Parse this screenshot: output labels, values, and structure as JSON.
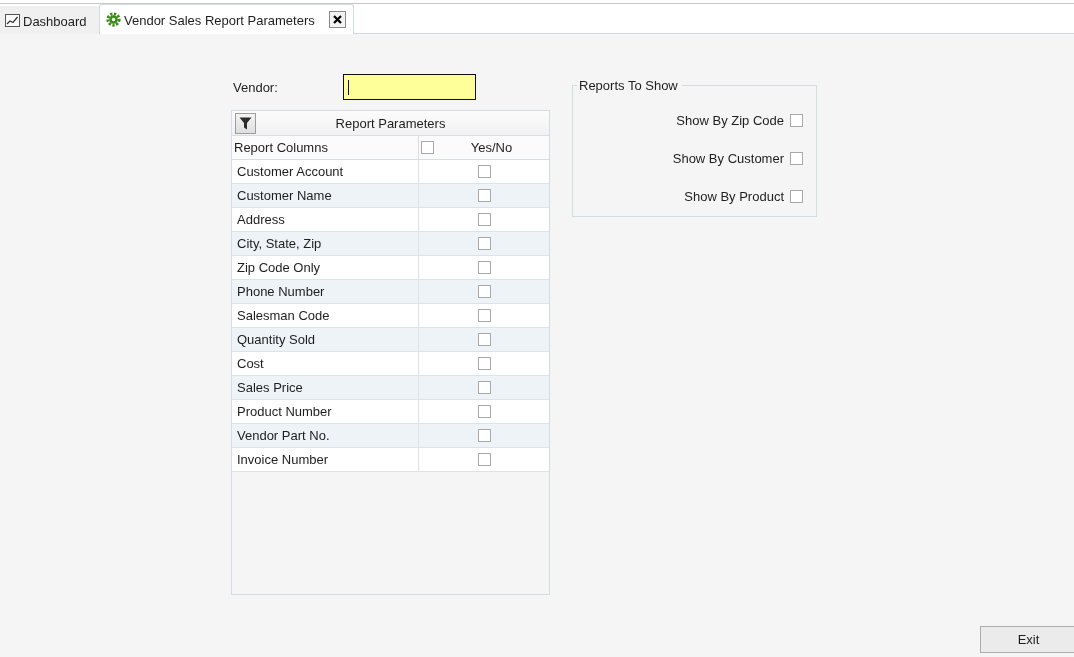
{
  "tabs": [
    {
      "label": "Dashboard",
      "kind": "chart",
      "selected": false,
      "closable": false
    },
    {
      "label": "Vendor Sales Report Parameters",
      "kind": "gear",
      "selected": true,
      "closable": true
    }
  ],
  "vendor": {
    "label": "Vendor:",
    "focused": true
  },
  "report_parameters": {
    "title": "Report Parameters",
    "columns": [
      "Report Columns",
      "Yes/No"
    ],
    "select_all_checked": false,
    "rows": [
      {
        "label": "Customer Account",
        "checked": false
      },
      {
        "label": "Customer Name",
        "checked": false
      },
      {
        "label": "Address",
        "checked": false
      },
      {
        "label": "City, State, Zip",
        "checked": false
      },
      {
        "label": "Zip Code Only",
        "checked": false
      },
      {
        "label": "Phone Number",
        "checked": false
      },
      {
        "label": "Salesman Code",
        "checked": false
      },
      {
        "label": "Quantity Sold",
        "checked": false
      },
      {
        "label": "Cost",
        "checked": false
      },
      {
        "label": "Sales Price",
        "checked": false
      },
      {
        "label": "Product Number",
        "checked": false
      },
      {
        "label": "Vendor Part No.",
        "checked": false
      },
      {
        "label": "Invoice Number",
        "checked": false
      }
    ]
  },
  "reports_to_show": {
    "title": "Reports To Show",
    "options": [
      {
        "label": "Show By Zip Code",
        "checked": false
      },
      {
        "label": "Show By Customer",
        "checked": false
      },
      {
        "label": "Show By Product",
        "checked": false
      }
    ]
  },
  "buttons": [
    {
      "label": "Exit"
    }
  ]
}
